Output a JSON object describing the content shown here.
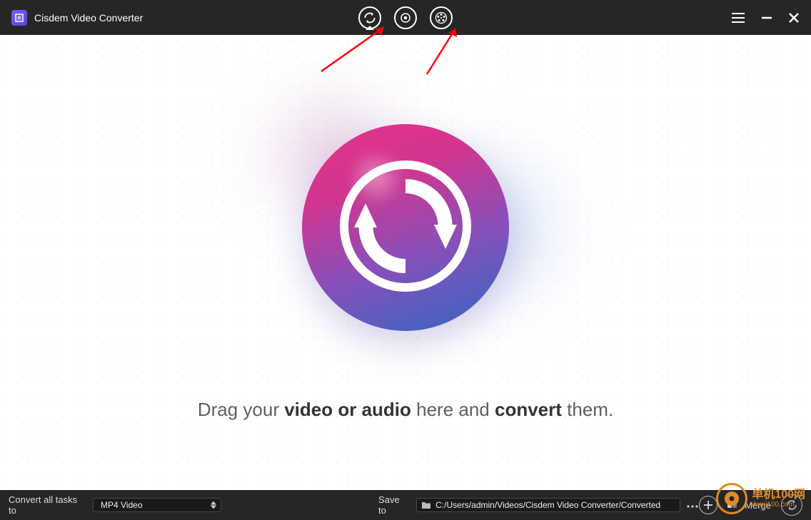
{
  "app": {
    "title": "Cisdem Video Converter"
  },
  "modes": {
    "convert": "convert-mode",
    "rip": "rip-dvd-mode",
    "download": "download-video-mode"
  },
  "hero": {
    "text_pre": "Drag your ",
    "text_bold1": "video or audio",
    "text_mid": " here and ",
    "text_bold2": "convert",
    "text_post": " them."
  },
  "footer": {
    "convert_label": "Convert all tasks to",
    "format": "MP4 Video",
    "saveto_label": "Save to",
    "path": "C:/Users/admin/Videos/Cisdem Video Converter/Converted",
    "merge_label": "Merge"
  },
  "watermark": {
    "cn": "单机100网",
    "url": "danji100.com"
  }
}
